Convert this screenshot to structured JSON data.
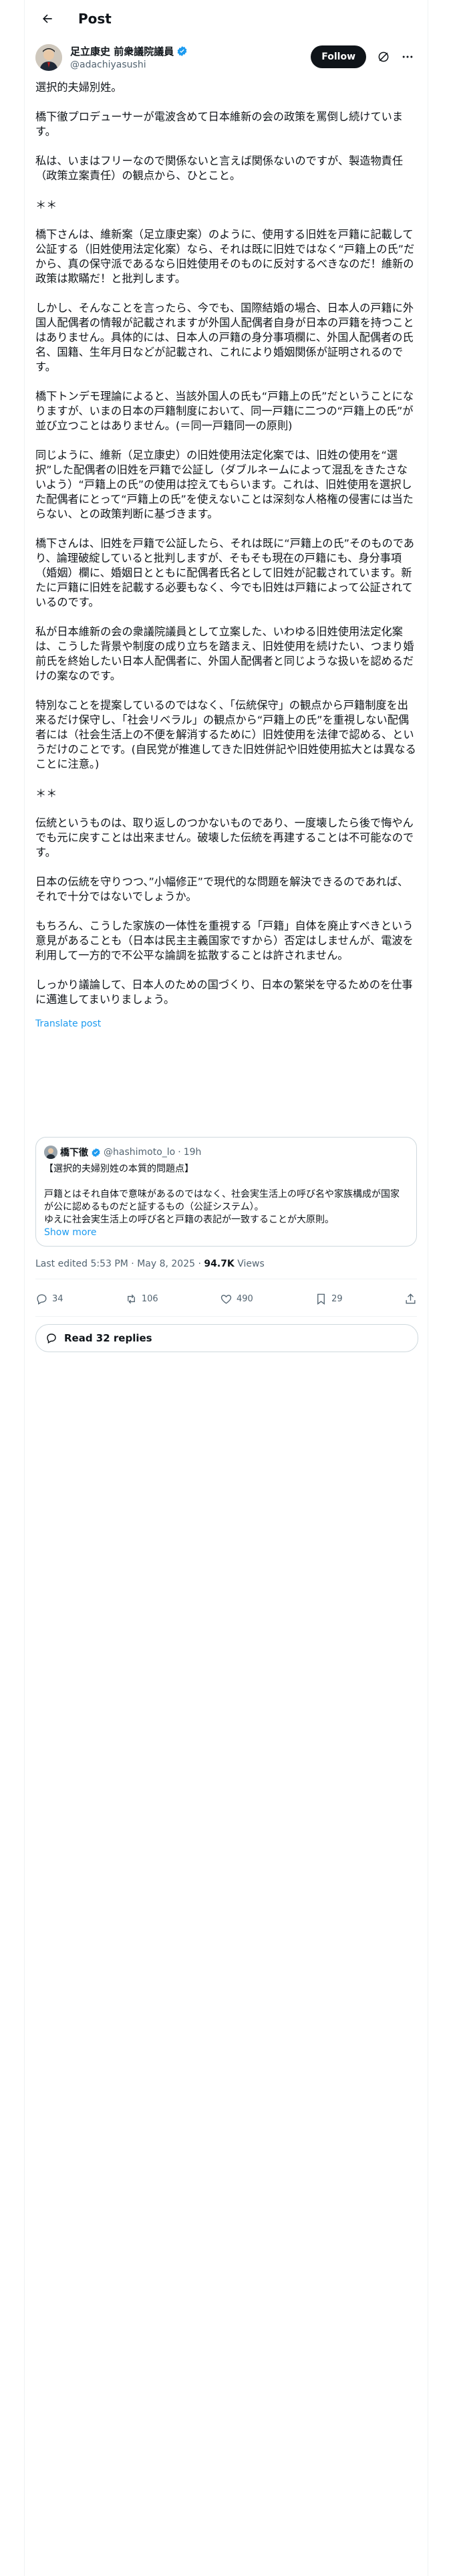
{
  "header": {
    "title": "Post"
  },
  "author": {
    "name": "足立康史 前衆議院議員",
    "handle": "@adachiyasushi",
    "follow_label": "Follow"
  },
  "body": [
    "選択的夫婦別姓。",
    "橋下徹プロデューサーが電波含めて日本維新の会の政策を罵倒し続けています。",
    "私は、いまはフリーなので関係ないと言えば関係ないのですが、製造物責任（政策立案責任）の観点から、ひとこと。",
    "＊＊",
    "橋下さんは、維新案（足立康史案）のように、使用する旧姓を戸籍に記載して公証する（旧姓使用法定化案）なら、それは既に旧姓ではなく“戸籍上の氏”だから、真の保守派であるなら旧姓使用そのものに反対するべきなのだ！維新の政策は欺瞞だ！と批判します。",
    "しかし、そんなことを言ったら、今でも、国際結婚の場合、日本人の戸籍に外国人配偶者の情報が記載されますが外国人配偶者自身が日本の戸籍を持つことはありません。具体的には、日本人の戸籍の身分事項欄に、外国人配偶者の氏名、国籍、生年月日などが記載され、これにより婚姻関係が証明されるのです。",
    "橋下トンデモ理論によると、当該外国人の氏も“戸籍上の氏”だということになりますが、いまの日本の戸籍制度において、同一戸籍に二つの“戸籍上の氏”が並び立つことはありません。(＝同一戸籍同一の原則)",
    "同じように、維新（足立康史）の旧姓使用法定化案では、旧姓の使用を“選択”した配偶者の旧姓を戸籍で公証し（ダブルネームによって混乱をきたさないよう）“戸籍上の氏”の使用は控えてもらいます。これは、旧姓使用を選択した配偶者にとって“戸籍上の氏”を使えないことは深刻な人格権の侵害には当たらない、との政策判断に基づきます。",
    "橋下さんは、旧姓を戸籍で公証したら、それは既に“戸籍上の氏”そのものであり、論理破綻していると批判しますが、そもそも現在の戸籍にも、身分事項（婚姻）欄に、婚姻日とともに配偶者氏名として旧姓が記載されています。新たに戸籍に旧姓を記載する必要もなく、今でも旧姓は戸籍によって公証されているのです。",
    "私が日本維新の会の衆議院議員として立案した、いわゆる旧姓使用法定化案は、こうした背景や制度の成り立ちを踏まえ、旧姓使用を続けたい、つまり婚前氏を終始したい日本人配偶者に、外国人配偶者と同じような扱いを認めるだけの案なのです。",
    "特別なことを提案しているのではなく、「伝統保守」の観点から戸籍制度を出来るだけ保守し、「社会リベラル」の観点から“戸籍上の氏”を重視しない配偶者には（社会生活上の不便を解消するために）旧姓使用を法律で認める、というだけのことです。(自民党が推進してきた旧姓併記や旧姓使用拡大とは異なることに注意。)",
    "＊＊",
    "伝統というものは、取り返しのつかないものであり、一度壊したら後で悔やんでも元に戻すことは出来ません。破壊した伝統を再建することは不可能なのです。",
    "日本の伝統を守りつつ、”小幅修正”で現代的な問題を解決できるのであれば、それで十分ではないでしょうか。",
    "もちろん、こうした家族の一体性を重視する「戸籍」自体を廃止すべきという意見があることも（日本は民主主義国家ですから）否定はしませんが、電波を利用して一方的で不公平な論調を拡散することは許されません。",
    "しっかり議論して、日本人のための国づくり、日本の繁栄を守るためのを仕事に邁進してまいりましょう。"
  ],
  "translate_label": "Translate post",
  "quote": {
    "name": "橋下徹",
    "handle": "@hashimoto_lo",
    "time": "19h",
    "title": "【選択的夫婦別姓の本質的問題点】",
    "text": "戸籍とはそれ自体で意味があるのではなく、社会実生活上の呼び名や家族構成が国家が公に認めるものだと証するもの（公証システム）。",
    "text2": "ゆえに社会実生活上の呼び名と戸籍の表記が一致することが大原則。",
    "show_more": "Show more"
  },
  "meta": {
    "edited": "Last edited 5:53 PM · May 8, 2025 · ",
    "views_count": "94.7K",
    "views_label": " Views"
  },
  "actions": {
    "reply": "34",
    "repost": "106",
    "like": "490",
    "bookmark": "29"
  },
  "replies_label": "Read 32 replies",
  "colors": {
    "accent": "#1d9bf0",
    "verified": "#1d9bf0",
    "text": "#0f1419",
    "muted": "#536471"
  }
}
